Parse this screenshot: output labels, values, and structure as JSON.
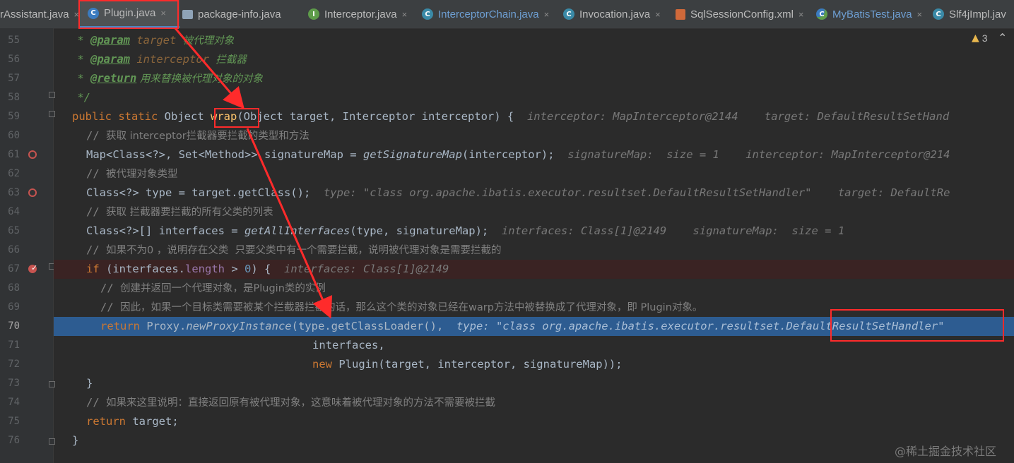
{
  "tabs": [
    {
      "label": "rAssistant.java",
      "icon": "none",
      "close": "×"
    },
    {
      "label": "Plugin.java",
      "icon": "C",
      "close": "×",
      "active": true
    },
    {
      "label": "package-info.java",
      "icon": "package-icon",
      "close": ""
    },
    {
      "label": "Interceptor.java",
      "icon": "I",
      "close": "×"
    },
    {
      "label": "InterceptorChain.java",
      "icon": "C",
      "close": "×"
    },
    {
      "label": "Invocation.java",
      "icon": "C",
      "close": "×"
    },
    {
      "label": "SqlSessionConfig.xml",
      "icon": "xml-icon",
      "close": "×"
    },
    {
      "label": "MyBatisTest.java",
      "icon": "C",
      "close": "×"
    },
    {
      "label": "Slf4jImpl.jav",
      "icon": "C",
      "close": ""
    }
  ],
  "inspection": {
    "count": "3"
  },
  "line_numbers": [
    "55",
    "56",
    "57",
    "58",
    "59",
    "60",
    "61",
    "62",
    "63",
    "64",
    "65",
    "66",
    "67",
    "68",
    "69",
    "70",
    "71",
    "72",
    "73",
    "74",
    "75",
    "76"
  ],
  "code": {
    "l55": {
      "a": " * ",
      "tag": "@param",
      "b": " target ",
      "c": "被代理对象"
    },
    "l56": {
      "a": " * ",
      "tag": "@param",
      "b": " interceptor ",
      "c": "拦截器"
    },
    "l57": {
      "a": " * ",
      "tag": "@return",
      "c": " 用来替换被代理对象的对象"
    },
    "l58": {
      "a": " */"
    },
    "l59": {
      "k1": "public",
      "k2": "static",
      "t1": " Object ",
      "fn": "wrap",
      "t2": "(Object target, Interceptor interceptor) {",
      "hint": "interceptor: MapInterceptor@2144    target: DefaultResultSetHand"
    },
    "l60": {
      "a": "// ",
      "c": "获取 interceptor拦截器要拦截的类型和方法"
    },
    "l61": {
      "t1": "Map<Class<?>, Set<Method>> signatureMap = ",
      "call": "getSignatureMap",
      "t2": "(interceptor);",
      "hint": "signatureMap:  size = 1    interceptor: MapInterceptor@214"
    },
    "l62": {
      "a": "// ",
      "c": "被代理对象类型"
    },
    "l63": {
      "t1": "Class<?> type = target.getClass();",
      "hint": "type: \"class org.apache.ibatis.executor.resultset.DefaultResultSetHandler\"    target: DefaultRe"
    },
    "l64": {
      "a": "// ",
      "c": "获取 拦截器要拦截的所有父类的列表"
    },
    "l65": {
      "t1": "Class<?>[] interfaces = ",
      "call": "getAllInterfaces",
      "t2": "(type, signatureMap);",
      "hint": "interfaces: Class[1]@2149    signatureMap:  size = 1"
    },
    "l66": {
      "a": "// ",
      "c": "如果不为0 ，说明存在父类  只要父类中有一个需要拦截，说明被代理对象是需要拦截的"
    },
    "l67": {
      "k1": "if",
      "t1": " (interfaces.",
      "f": "length",
      "t2": " > ",
      "n": "0",
      "t3": ") {",
      "hint": "interfaces: Class[1]@2149"
    },
    "l68": {
      "a": "// ",
      "c": "创建并返回一个代理对象，是Plugin类的实例"
    },
    "l69": {
      "a": "// ",
      "c": "因此，如果一个目标类需要被某个拦截器拦截的话，那么这个类的对象已经在warp方法中被替换成了代理对象，即 Plugin对象。"
    },
    "l70": {
      "k1": "return",
      "t1": " Proxy.",
      "call": "newProxyInstance",
      "t2": "(type.getClassLoader(),",
      "hint": "type: \"class org.apache.ibatis.executor.resultset.DefaultResultSetHandler\""
    },
    "l71": {
      "t1": "interfaces,"
    },
    "l72": {
      "k1": "new",
      "t1": " Plugin(target, interceptor, signatureMap));"
    },
    "l73": {
      "t1": "}"
    },
    "l74": {
      "a": "// ",
      "c": "如果来这里说明：直接返回原有被代理对象，这意味着被代理对象的方法不需要被拦截"
    },
    "l75": {
      "k1": "return",
      "t1": " target;"
    },
    "l76": {
      "t1": "}"
    }
  },
  "watermark": "@稀土掘金技术社区",
  "colors": {
    "background": "#2b2b2b",
    "exec_line": "#2d5c91",
    "breakpoint": "#c75450",
    "annotation_red": "#ff2b2b"
  }
}
